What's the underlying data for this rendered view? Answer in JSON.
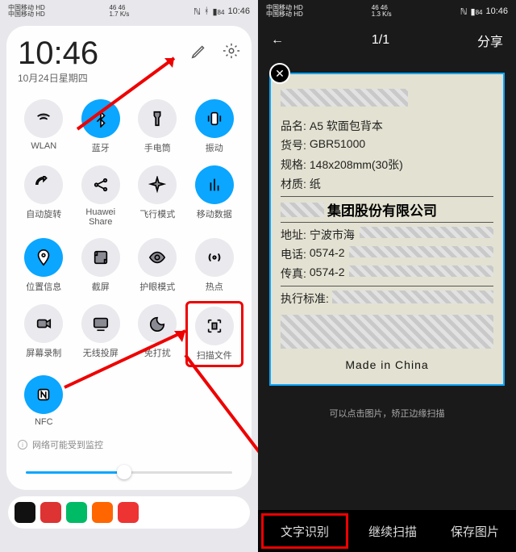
{
  "left": {
    "status": {
      "carrier1": "中国移动 HD",
      "carrier2": "中国移动 HD",
      "sig": "46 46",
      "speed": "1.7 K/s",
      "nfc": "ℕ",
      "bt": "ᚼ",
      "bat": "84",
      "time": "10:46"
    },
    "clock": "10:46",
    "date": "10月24日星期四",
    "tiles": [
      {
        "label": "WLAN",
        "icon": "wifi",
        "on": false
      },
      {
        "label": "蓝牙",
        "icon": "bluetooth",
        "on": true
      },
      {
        "label": "手电筒",
        "icon": "flashlight",
        "on": false
      },
      {
        "label": "振动",
        "icon": "vibrate",
        "on": true
      },
      {
        "label": "自动旋转",
        "icon": "rotate",
        "on": false
      },
      {
        "label": "Huawei Share",
        "icon": "share",
        "on": false
      },
      {
        "label": "飞行模式",
        "icon": "airplane",
        "on": false
      },
      {
        "label": "移动数据",
        "icon": "data",
        "on": true
      },
      {
        "label": "位置信息",
        "icon": "location",
        "on": true
      },
      {
        "label": "截屏",
        "icon": "screenshot",
        "on": false
      },
      {
        "label": "护眼模式",
        "icon": "eye",
        "on": false
      },
      {
        "label": "热点",
        "icon": "hotspot",
        "on": false
      },
      {
        "label": "屏幕录制",
        "icon": "record",
        "on": false
      },
      {
        "label": "无线投屏",
        "icon": "cast",
        "on": false
      },
      {
        "label": "免打扰",
        "icon": "dnd",
        "on": false
      },
      {
        "label": "扫描文件",
        "icon": "scan",
        "on": false,
        "highlight": true
      },
      {
        "label": "NFC",
        "icon": "nfc",
        "on": true
      }
    ],
    "warning": "网络可能受到监控",
    "dock_colors": [
      "#111",
      "#d33",
      "#0b6",
      "#f60",
      "#e33"
    ]
  },
  "right": {
    "status": {
      "carrier1": "中国移动 HD",
      "carrier2": "中国移动 HD",
      "sig": "46 46",
      "speed": "1.3 K/s",
      "bat": "84",
      "time": "10:46"
    },
    "counter": "1/1",
    "share": "分享",
    "doc": {
      "rows": [
        {
          "k": "品名:",
          "v": "A5 软面包背本"
        },
        {
          "k": "货号:",
          "v": "GBR51000"
        },
        {
          "k": "规格:",
          "v": "148x208mm(30张)"
        },
        {
          "k": "材质:",
          "v": "纸"
        }
      ],
      "company_suffix": "集团股份有限公司",
      "rows2": [
        {
          "k": "地址:",
          "v": "宁波市海"
        },
        {
          "k": "电话:",
          "v": "0574-2"
        },
        {
          "k": "传真:",
          "v": "0574-2"
        }
      ],
      "std_label": "执行标准:",
      "mic": "Made in China"
    },
    "hint": "可以点击图片，矫正边缘扫描",
    "buttons": [
      "文字识别",
      "继续扫描",
      "保存图片"
    ]
  }
}
